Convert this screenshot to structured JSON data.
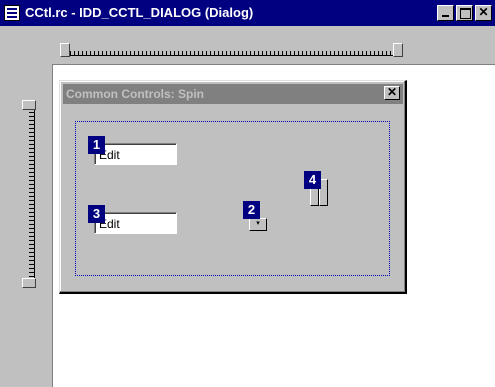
{
  "window": {
    "title": "CCtl.rc - IDD_CCTL_DIALOG (Dialog)",
    "icon": "resource-file-icon",
    "buttons": {
      "minimize": "minimize-icon",
      "maximize": "maximize-icon",
      "close": "✕"
    }
  },
  "dialog": {
    "caption": "Common Controls: Spin",
    "close_glyph": "✕",
    "controls": [
      {
        "tab_order": "1",
        "type": "edit",
        "text": "Edit"
      },
      {
        "tab_order": "2",
        "type": "spin-horizontal",
        "glyph": "▾"
      },
      {
        "tab_order": "3",
        "type": "edit",
        "text": "Edit"
      },
      {
        "tab_order": "4",
        "type": "spin-vertical"
      }
    ]
  },
  "colors": {
    "title_bar": "#000080",
    "tab_badge": "#000080",
    "dialog_face": "#c0c0c0",
    "inactive_caption": "#808080"
  }
}
